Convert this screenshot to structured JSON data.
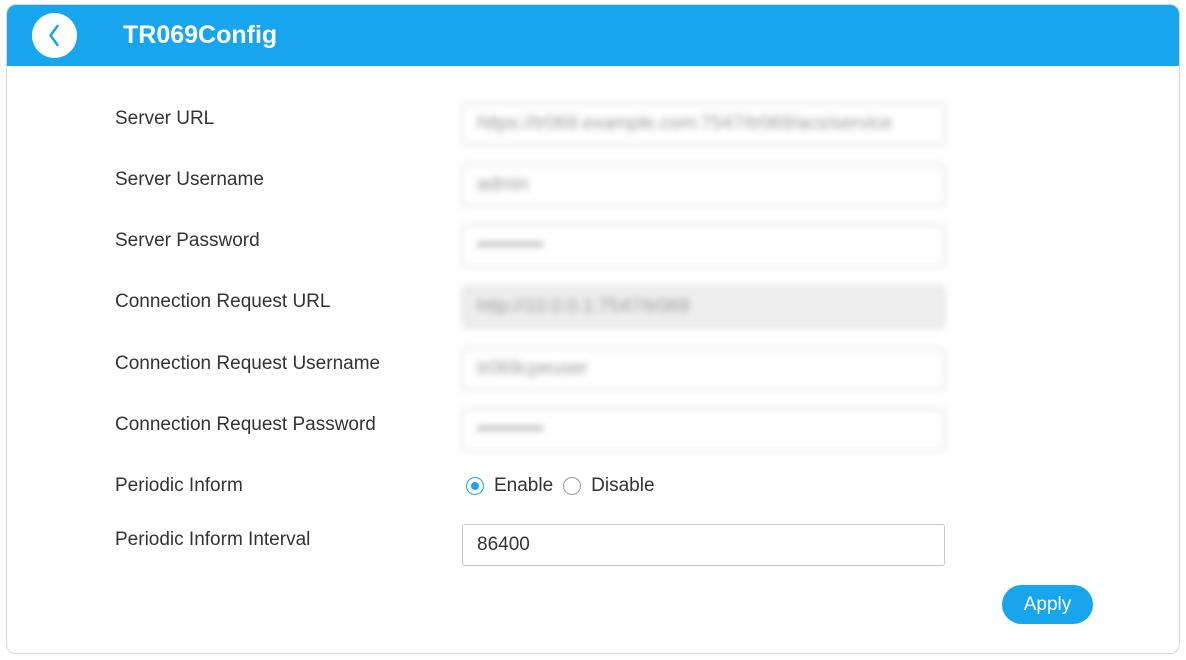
{
  "header": {
    "title": "TR069Config",
    "back_icon": "chevron-left-icon"
  },
  "form": {
    "server_url": {
      "label": "Server URL",
      "value": "https://tr069.example.com:7547/tr069/acs/service"
    },
    "server_username": {
      "label": "Server Username",
      "value": "admin"
    },
    "server_password": {
      "label": "Server Password",
      "value": "••••••••••"
    },
    "connection_request_url": {
      "label": "Connection Request URL",
      "value": "http://10.0.0.1:7547/tr069"
    },
    "connection_request_username": {
      "label": "Connection Request Username",
      "value": "tr069cpeuser"
    },
    "connection_request_password": {
      "label": "Connection Request Password",
      "value": "••••••••••"
    },
    "periodic_inform": {
      "label": "Periodic Inform",
      "options": [
        "Enable",
        "Disable"
      ],
      "selected": "Enable"
    },
    "periodic_inform_interval": {
      "label": "Periodic Inform Interval",
      "value": "86400"
    }
  },
  "actions": {
    "apply_label": "Apply"
  },
  "colors": {
    "accent": "#17a6ee",
    "readonly_bg": "#eeeeee"
  }
}
